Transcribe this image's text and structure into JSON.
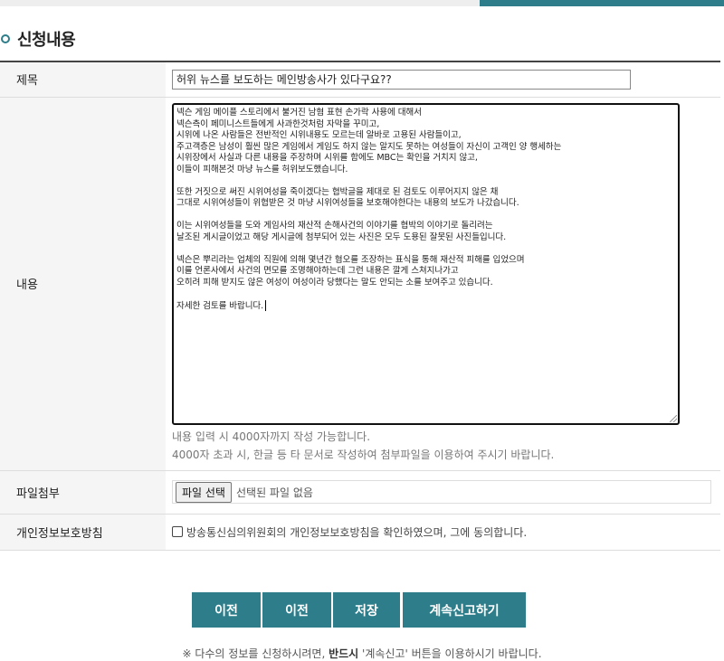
{
  "section": {
    "heading": "신청내용"
  },
  "form": {
    "title_label": "제목",
    "title_value": "허위 뉴스를 보도하는 메인방송사가 있다구요??",
    "content_label": "내용",
    "content_lines": [
      "넥슨 게임 메이플 스토리에서 불거진 남혐 표현 손가락 사용에 대해서",
      "넥슨측이 페미니스트들에게 사과한것처럼 자막을 꾸미고,",
      "시위에 나온 사람들은 전반적인 시위내용도 모르는데 알바로 고용된 사람들이고,",
      "주고객층은 남성이 훨씬 많은 게임에서 게임도 하지 않는 알지도 못하는 여성들이 자신이 고객인 양 행세하는",
      "시위장에서 사실과 다른 내용을 주장하며 시위를 함에도 MBC는 확인을 거치지 않고,",
      "이들이 피해본것 마냥 뉴스를 허위보도했습니다.",
      "",
      "또한 거짓으로 써진 시위여성을 죽이겠다는 협박글을 제대로 된 검토도 이루어지지 않은 채",
      "그대로 시위여성들이 위협받은 것 마냥 시위여성들을 보호해야한다는 내용의 보도가 나갔습니다.",
      "",
      "이는 시위여성들을 도와 게임사의 재산적 손해사건의 이야기를 협박의 이야기로 돌리려는",
      "날조된 게시글이었고 해당 게시글에 첨부되어 있는 사진은 모두 도용된 잘못된 사진들입니다.",
      "",
      "넥슨은 뿌리라는 업체의 직원에 의해 몇년간 혐오를 조장하는 표식을 통해 재산적 피해를 입었으며",
      "이를 언론사에서 사건의 면모를 조명해야하는데 그런 내용은 깔게 스쳐지나가고",
      "오히려 피해 받지도 않은 여성이 여성이라 당했다는 말도 안되는 소를 보여주고 있습니다.",
      "",
      "자세한 검토를 바랍니다."
    ],
    "content_help_1": "내용 입력 시 4000자까지 작성 가능합니다.",
    "content_help_2": "4000자 초과 시, 한글 등 타 문서로 작성하여 첨부파일을 이용하여 주시기 바랍니다.",
    "file_label": "파일첨부",
    "file_button": "파일 선택",
    "file_status": "선택된 파일 없음",
    "privacy_label": "개인정보보호방침",
    "privacy_text": "방송통신심의위원회의 개인정보보호방침을 확인하였으며, 그에 동의합니다."
  },
  "actions": {
    "prev1": "이전",
    "prev2": "이전",
    "save": "저장",
    "continue": "계속신고하기"
  },
  "notice": {
    "prefix": "※ 다수의 정보를 신청하시려면, ",
    "emphasis": "반드시",
    "suffix": " '계속신고' 버튼을 이용하시기 바랍니다."
  },
  "colors": {
    "accent": "#2d7d8a"
  }
}
